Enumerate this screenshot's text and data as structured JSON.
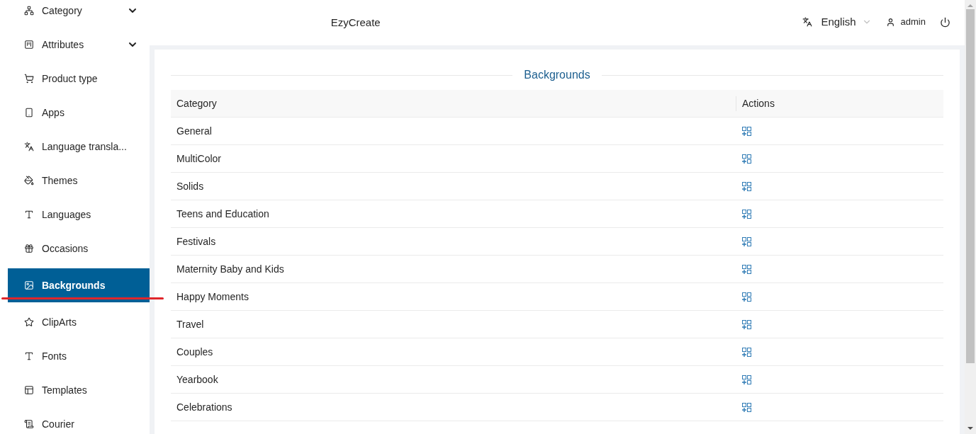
{
  "sidebar": {
    "items": [
      {
        "label": "Category",
        "expandable": true,
        "selected": false
      },
      {
        "label": "Attributes",
        "expandable": true,
        "selected": false
      },
      {
        "label": "Product type",
        "expandable": false,
        "selected": false
      },
      {
        "label": "Apps",
        "expandable": false,
        "selected": false
      },
      {
        "label": "Language transla...",
        "expandable": false,
        "selected": false
      },
      {
        "label": "Themes",
        "expandable": false,
        "selected": false
      },
      {
        "label": "Languages",
        "expandable": false,
        "selected": false
      },
      {
        "label": "Occasions",
        "expandable": false,
        "selected": false
      },
      {
        "label": "Backgrounds",
        "expandable": false,
        "selected": true
      },
      {
        "label": "ClipArts",
        "expandable": false,
        "selected": false
      },
      {
        "label": "Fonts",
        "expandable": false,
        "selected": false
      },
      {
        "label": "Templates",
        "expandable": false,
        "selected": false
      },
      {
        "label": "Courier",
        "expandable": false,
        "selected": false
      }
    ]
  },
  "header": {
    "title": "EzyCreate",
    "language": "English",
    "user": "admin"
  },
  "page": {
    "title": "Backgrounds"
  },
  "table": {
    "columns": [
      "Category",
      "Actions"
    ],
    "rows": [
      "General",
      "MultiColor",
      "Solids",
      "Teens and Education",
      "Festivals",
      "Maternity Baby and Kids",
      "Happy Moments",
      "Travel",
      "Couples",
      "Yearbook",
      "Celebrations"
    ]
  }
}
